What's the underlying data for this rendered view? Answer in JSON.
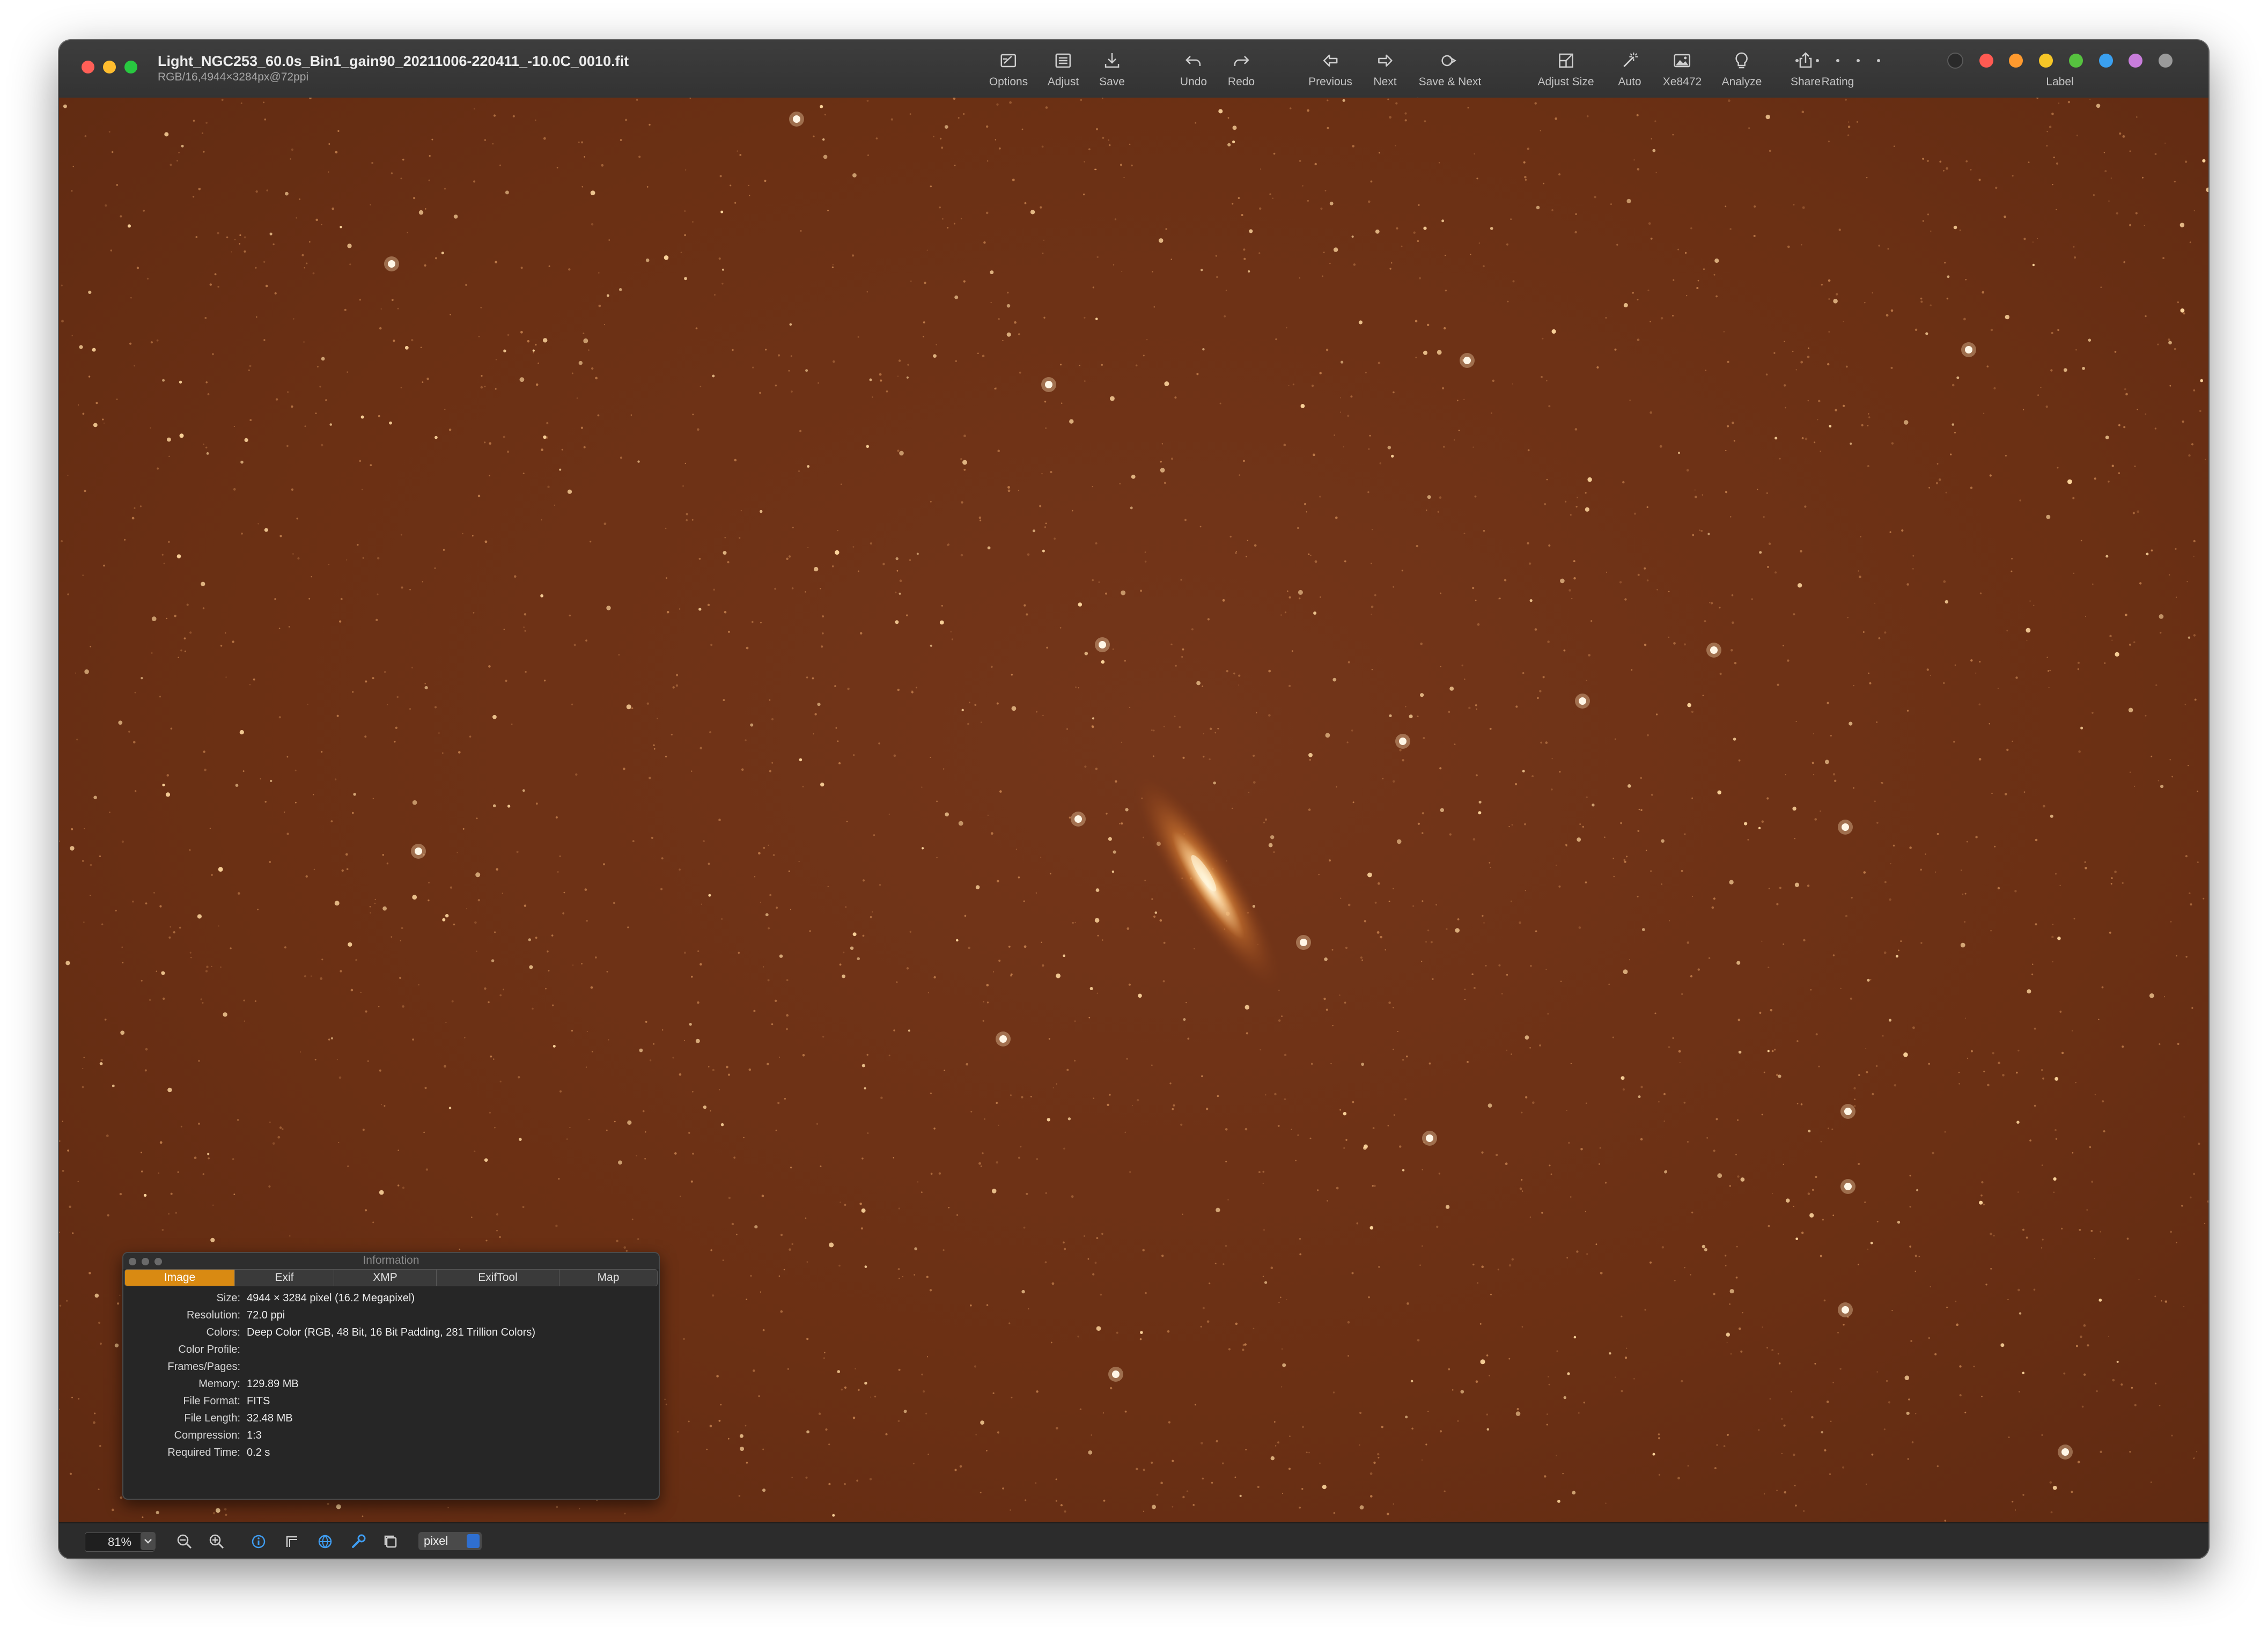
{
  "window": {
    "title": "Light_NGC253_60.0s_Bin1_gain90_20211006-220411_-10.0C_0010.fit",
    "subtitle": "RGB/16,4944×3284px@72ppi"
  },
  "toolbar": {
    "options": "Options",
    "adjust": "Adjust",
    "save": "Save",
    "undo": "Undo",
    "redo": "Redo",
    "previous": "Previous",
    "next": "Next",
    "save_next": "Save & Next",
    "adjust_size": "Adjust Size",
    "auto": "Auto",
    "xe847": "Xe8472",
    "analyze": "Analyze",
    "share": "Share",
    "rating": "Rating",
    "label": "Label",
    "label_colors": [
      "#ff5a52",
      "#ff9a2e",
      "#f6c627",
      "#56c23f",
      "#3aa0f0",
      "#c87ddb",
      "#9a9a9a"
    ]
  },
  "info_panel": {
    "title": "Information",
    "tabs": [
      "Image",
      "Exif",
      "XMP",
      "ExifTool",
      "Map"
    ],
    "active_tab": "Image",
    "rows": [
      {
        "key": "Size:",
        "value": "4944 × 3284 pixel (16.2 Megapixel)"
      },
      {
        "key": "Resolution:",
        "value": "72.0 ppi"
      },
      {
        "key": "Colors:",
        "value": "Deep Color (RGB, 48 Bit, 16 Bit Padding, 281 Trillion Colors)"
      },
      {
        "key": "Color Profile:",
        "value": ""
      },
      {
        "key": "Frames/Pages:",
        "value": ""
      },
      {
        "key": "Memory:",
        "value": "129.89 MB"
      },
      {
        "key": "File Format:",
        "value": "FITS"
      },
      {
        "key": "File Length:",
        "value": "32.48 MB"
      },
      {
        "key": "Compression:",
        "value": "1:3"
      },
      {
        "key": "Required Time:",
        "value": "0.2 s"
      }
    ]
  },
  "statusbar": {
    "zoom": "81%",
    "unit": "pixel"
  },
  "colors": {
    "accent": "#d98a12",
    "canvas": "#6b3014"
  }
}
